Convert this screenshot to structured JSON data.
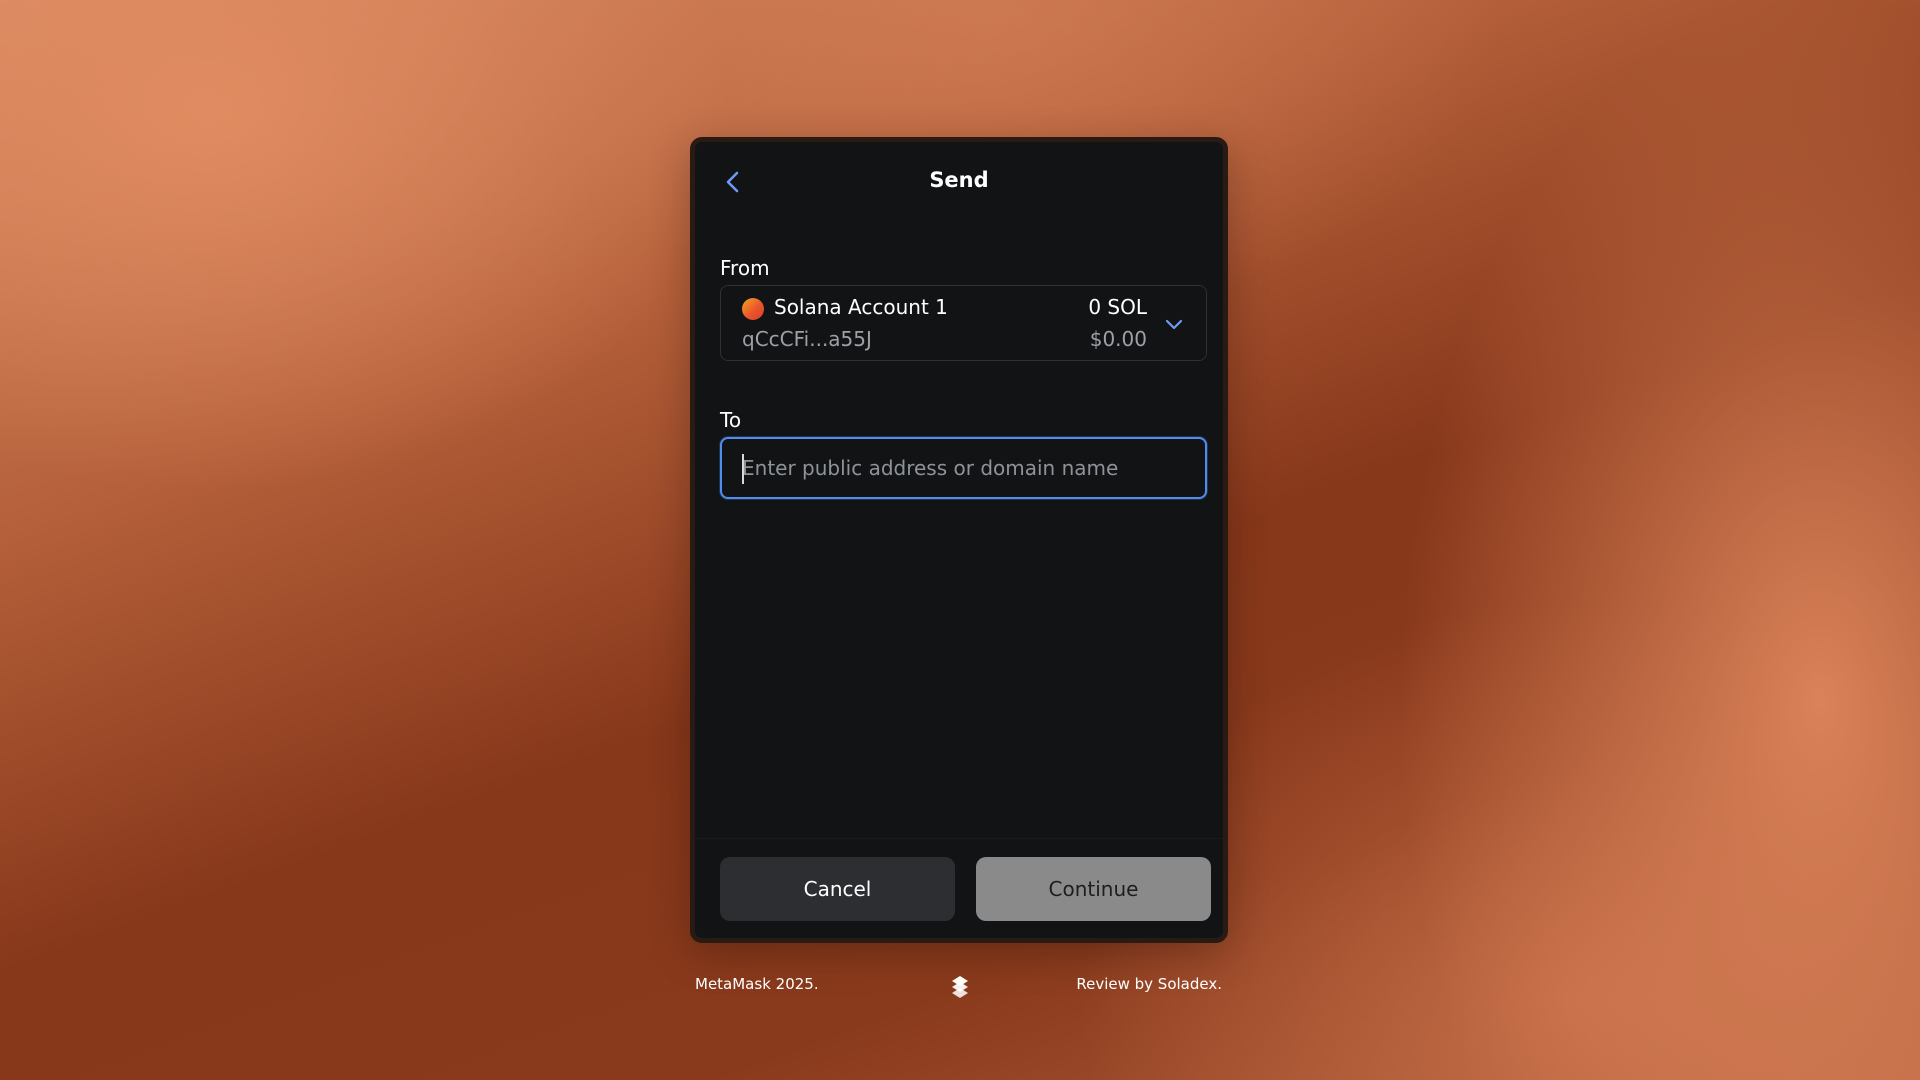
{
  "header": {
    "title": "Send"
  },
  "from": {
    "label": "From",
    "account_name": "Solana Account 1",
    "account_address": "qCcCFi...a55J",
    "balance": "0 SOL",
    "fiat_balance": "$0.00"
  },
  "to": {
    "label": "To",
    "placeholder": "Enter public address or domain name",
    "value": ""
  },
  "actions": {
    "cancel_label": "Cancel",
    "continue_label": "Continue"
  },
  "page_footer": {
    "left_text": "MetaMask 2025.",
    "right_text": "Review by Soladex."
  },
  "icons": {
    "back": "chevron-left-icon",
    "dropdown": "chevron-down-icon",
    "account_avatar": "account-avatar-icon",
    "brand_logo": "soladex-logo-icon"
  },
  "colors": {
    "accent": "#4f8ef0",
    "panel_background": "#121314",
    "continue_disabled": "#8a8a8a"
  }
}
